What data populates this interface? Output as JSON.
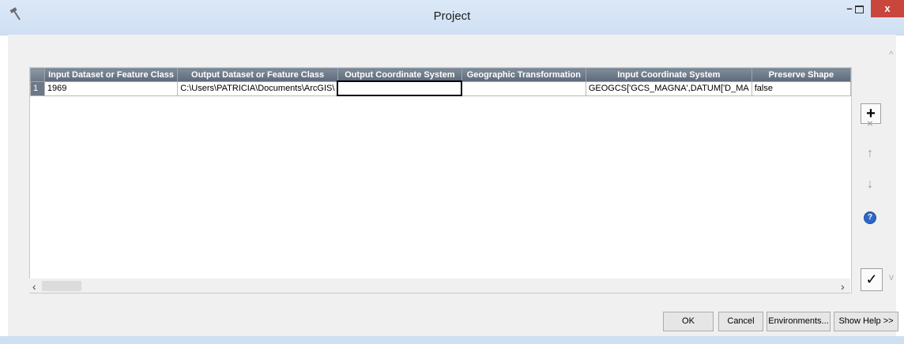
{
  "window": {
    "title": "Project",
    "min_symbol": "–",
    "close_symbol": "x"
  },
  "grid": {
    "columns": [
      "Input Dataset or Feature Class",
      "Output Dataset or Feature Class",
      "Output Coordinate System",
      "Geographic Transformation",
      "Input Coordinate System",
      "Preserve Shape"
    ],
    "rows": [
      {
        "num": "1",
        "cells": [
          "1969",
          "C:\\Users\\PATRICIA\\Documents\\ArcGIS\\",
          "",
          "",
          "GEOGCS['GCS_MAGNA',DATUM['D_MA",
          "false"
        ]
      }
    ]
  },
  "side_buttons": {
    "add": "+",
    "delete": "×",
    "up": "↑",
    "down": "↓",
    "help": "?",
    "check": "✓"
  },
  "scroll": {
    "left": "‹",
    "right": "›",
    "up": "^",
    "down": "v"
  },
  "footer": {
    "ok": "OK",
    "cancel": "Cancel",
    "environments": "Environments...",
    "show_help": "Show Help >>"
  }
}
